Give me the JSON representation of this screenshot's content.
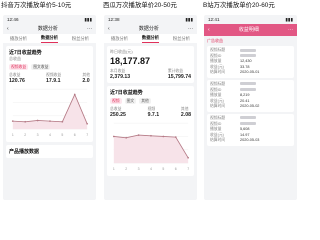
{
  "banners": [
    "抖音万次播放单价5-10元",
    "西瓜万次播放单价20-50元",
    "B站万次播放单价20-60元"
  ],
  "left": {
    "time": "12:46",
    "nav_title": "数据分析",
    "tabs": [
      "播放分析",
      "数据分析",
      "粉丝分析"
    ],
    "card_title": "近7日收益趋势",
    "subtitle": "总收益",
    "pills": [
      "视频收益",
      "图文收益"
    ],
    "stats": [
      {
        "label": "总收益",
        "value": "120.76"
      },
      {
        "label": "视频收益",
        "value": "17.9.1"
      },
      {
        "label": "其他",
        "value": "2.0"
      }
    ],
    "bottom_label": "产品播放数据",
    "chart_data": {
      "type": "line",
      "x": [
        "1",
        "2",
        "3",
        "4",
        "5",
        "6",
        "7"
      ],
      "values": [
        12,
        11,
        13,
        12,
        11,
        52,
        8
      ],
      "ylim": [
        0,
        60
      ]
    }
  },
  "middle": {
    "time": "12:38",
    "nav_title": "数据分析",
    "tabs": [
      "播放分析",
      "数据分析",
      "粉丝分析"
    ],
    "headline_label": "昨日收益(元)",
    "headline_value": "18,177.87",
    "sub_stats": [
      {
        "label": "本月收益",
        "value": "2,379.13"
      },
      {
        "label": "累计收益",
        "value": "15,799.74"
      }
    ],
    "card_title": "近7日收益趋势",
    "pills": [
      "视频",
      "图文",
      "其他"
    ],
    "stats": [
      {
        "label": "总收益",
        "value": "250.25"
      },
      {
        "label": "视频",
        "value": "9.7.1"
      },
      {
        "label": "其他",
        "value": "2.08"
      }
    ],
    "chart_data": {
      "type": "line",
      "x": [
        "1",
        "2",
        "3",
        "4",
        "5",
        "6",
        "7"
      ],
      "values": [
        40,
        38,
        42,
        41,
        40,
        39,
        8
      ],
      "ylim": [
        0,
        60
      ]
    }
  },
  "right": {
    "time": "12:41",
    "header_title": "收益明细",
    "section_label": "广告收益",
    "rows": [
      {
        "k": "视频标题",
        "v": ""
      },
      {
        "k": "视频ID",
        "v": ""
      },
      {
        "k": "播放量",
        "v": "12,430"
      },
      {
        "k": "收益(元)",
        "v": "33.78"
      },
      {
        "k": "结算时间",
        "v": "2020-05-01"
      },
      {
        "k": "视频标题",
        "v": ""
      },
      {
        "k": "视频ID",
        "v": ""
      },
      {
        "k": "播放量",
        "v": "8,219"
      },
      {
        "k": "收益(元)",
        "v": "20.41"
      },
      {
        "k": "结算时间",
        "v": "2020-05-02"
      },
      {
        "k": "视频标题",
        "v": ""
      },
      {
        "k": "视频ID",
        "v": ""
      },
      {
        "k": "播放量",
        "v": "5,608"
      },
      {
        "k": "收益(元)",
        "v": "14.97"
      },
      {
        "k": "结算时间",
        "v": "2020-05-03"
      }
    ]
  }
}
